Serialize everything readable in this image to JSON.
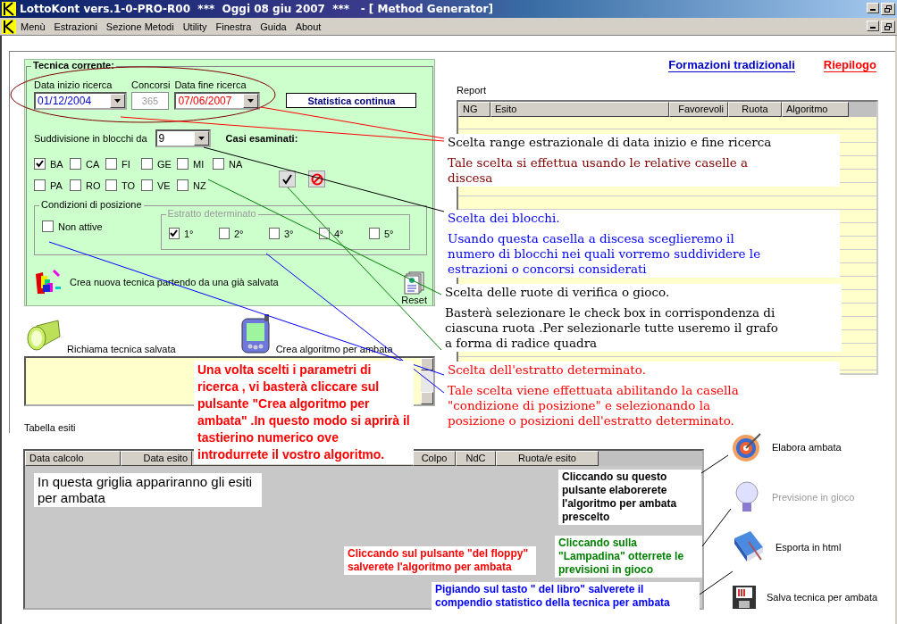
{
  "window": {
    "title": "LottoKont vers.1-0-PRO-R00  ***  Oggi 08 giu 2007  ***   - [ Method Generator]"
  },
  "menu": [
    "Menù",
    "Estrazioni",
    "Sezione Metodi",
    "Utility",
    "Finestra",
    "Guida",
    "About"
  ],
  "technique": {
    "title": "Tecnica corrente:",
    "start_date": {
      "label": "Data inizio ricerca",
      "value": "01/12/2004"
    },
    "draws": {
      "label": "Concorsi",
      "value": "365",
      "disabled": true
    },
    "end_date": {
      "label": "Data fine ricerca",
      "value": "07/06/2007"
    },
    "mode_button": "Statistica continua",
    "blocks": {
      "label": "Suddivisione in blocchi da",
      "value": "9"
    },
    "cases_label": "Casi esaminati:",
    "wheels": [
      {
        "label": "BA",
        "checked": true
      },
      {
        "label": "CA",
        "checked": false
      },
      {
        "label": "FI",
        "checked": false
      },
      {
        "label": "GE",
        "checked": false
      },
      {
        "label": "MI",
        "checked": false
      },
      {
        "label": "NA",
        "checked": false
      },
      {
        "label": "PA",
        "checked": false
      },
      {
        "label": "RO",
        "checked": false
      },
      {
        "label": "TO",
        "checked": false
      },
      {
        "label": "VE",
        "checked": false
      },
      {
        "label": "NZ",
        "checked": false
      }
    ],
    "position": {
      "title": "Condizioni di posizione",
      "inactive": {
        "label": "Non attive",
        "checked": false
      },
      "extract_title": "Estratto determinato",
      "positions": [
        {
          "label": "1°",
          "checked": true
        },
        {
          "label": "2°",
          "checked": false
        },
        {
          "label": "3°",
          "checked": false
        },
        {
          "label": "4°",
          "checked": false
        },
        {
          "label": "5°",
          "checked": false
        }
      ]
    },
    "create_from_saved": "Crea nuova tecnica partendo da una già salvata",
    "reset": "Reset"
  },
  "actions": {
    "load": "Richiama tecnica salvata",
    "create": "Crea algoritmo per ambata"
  },
  "results_label": "Tabella esiti",
  "results_columns": [
    "Data calcolo",
    "Data esito",
    "Colpo",
    "NdC",
    "Ruota/e esito"
  ],
  "links": [
    {
      "label": "Formazioni tradizionali",
      "color": "#0000cc"
    },
    {
      "label": "Riepilogo",
      "color": "#ff0000"
    }
  ],
  "report": {
    "title": "Report",
    "columns": [
      "NG",
      "Esito",
      "Favorevoli",
      "Ruota",
      "Algoritmo"
    ]
  },
  "side_buttons": [
    {
      "kind": "target",
      "label": "Elabora ambata",
      "disabled": false
    },
    {
      "kind": "bulb",
      "label": "Previsione in gioco",
      "disabled": true
    },
    {
      "kind": "book",
      "label": "Esporta in html",
      "disabled": false
    },
    {
      "kind": "floppy",
      "label": "Salva tecnica per ambata",
      "disabled": false
    }
  ],
  "callouts": [
    {
      "kind": "serif",
      "paragraphs": [
        {
          "text": "Scelta range estrazionale di data inizio e fine ricerca",
          "color": "#000000"
        },
        {
          "text": "Tale scelta si effettua usando le relative caselle a discesa",
          "color": "#800000"
        }
      ]
    },
    {
      "kind": "serif",
      "paragraphs": [
        {
          "text": "Scelta dei blocchi.",
          "color": "#0000ff"
        },
        {
          "text": "Usando questa casella a discesa sceglieremo il numero di blocchi nei quali vorremo suddividere le estrazioni o concorsi considerati",
          "color": "#0000ff"
        }
      ]
    },
    {
      "kind": "serif",
      "paragraphs": [
        {
          "text": "Scelta delle ruote di verifica o gioco.",
          "color": "#000000"
        },
        {
          "text": "Basterà selezionare le check box in corrispondenza di ciascuna ruota .Per selezionarle tutte useremo il grafo a forma di radice quadra",
          "color": "#000000"
        }
      ]
    },
    {
      "kind": "big",
      "paragraphs": [
        {
          "text": "Una volta scelti i parametri di ricerca , vi basterà cliccare sul pulsante \"Crea algoritmo per ambata\" .In questo modo si aprirà il tastierino numerico ove introdurrete il vostro algoritmo.",
          "color": "#ff0000"
        }
      ]
    },
    {
      "kind": "serif",
      "paragraphs": [
        {
          "text": "Scelta dell'estratto determinato.",
          "color": "#ff0000"
        },
        {
          "text": "Tale scelta viene effettuata abilitando la casella \"condizione di posizione\" e selezionando la posizione o posizioni dell'estratto determinato.",
          "color": "#ff0000"
        }
      ]
    },
    {
      "kind": "plain",
      "paragraphs": [
        {
          "text": "In questa griglia appariranno gli esiti per ambata",
          "color": "#000000"
        }
      ]
    },
    {
      "kind": "small",
      "paragraphs": [
        {
          "text": "Cliccando su questo pulsante elaborerete l'algoritmo per ambata prescelto",
          "color": "#000000"
        }
      ]
    },
    {
      "kind": "small",
      "paragraphs": [
        {
          "text": "Cliccando sul pulsante \"del floppy\" salverete l'algoritmo per ambata",
          "color": "#ff0000"
        }
      ]
    },
    {
      "kind": "small",
      "paragraphs": [
        {
          "text": "Cliccando sulla \"Lampadina\" otterrete le previsioni in gioco",
          "color": "#008000"
        }
      ]
    },
    {
      "kind": "small",
      "paragraphs": [
        {
          "text": "Pigiando sul tasto \" del libro\" salverete il compendio statistico della tecnica per ambata",
          "color": "#0000ff"
        }
      ]
    }
  ]
}
